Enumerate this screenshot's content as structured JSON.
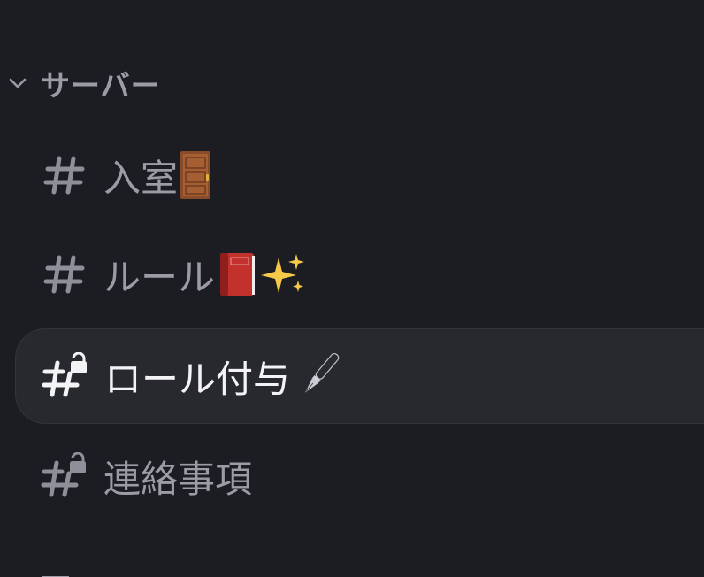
{
  "category": {
    "label": "サーバー",
    "icon": "chevron-down-icon",
    "color": "#9b9ca6"
  },
  "channels": [
    {
      "name": "入室",
      "icon": "hash-icon",
      "emoji": "door-emoji",
      "locked": false,
      "active": false
    },
    {
      "name": "ルール",
      "icon": "hash-icon",
      "emoji": "book-sparkles-emoji",
      "locked": false,
      "active": false
    },
    {
      "name": "ロール付与",
      "icon": "hash-lock-icon",
      "emoji": "fountain-pen-emoji",
      "locked": true,
      "active": true
    },
    {
      "name": "連絡事項",
      "icon": "hash-lock-icon",
      "emoji": "",
      "locked": true,
      "active": false
    }
  ],
  "colors": {
    "background": "#1c1d22",
    "active_row": "#28292f",
    "text_muted": "#9b9ca6",
    "text_active": "#f3f3f5"
  }
}
